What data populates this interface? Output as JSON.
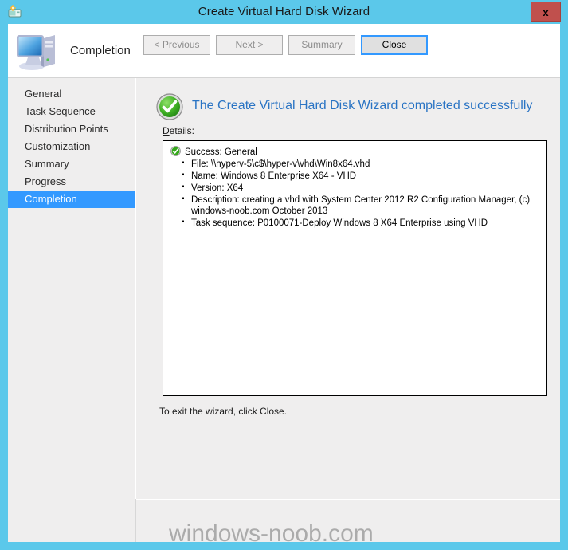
{
  "window": {
    "title": "Create Virtual Hard Disk Wizard",
    "title_icon": "vhd-wizard-icon",
    "close_label": "x",
    "accent_color": "#5bc8ea",
    "close_button_color": "#c0504d"
  },
  "header": {
    "icon": "computer-icon",
    "title": "Completion"
  },
  "sidebar": {
    "items": [
      {
        "label": "General",
        "active": false
      },
      {
        "label": "Task Sequence",
        "active": false
      },
      {
        "label": "Distribution Points",
        "active": false
      },
      {
        "label": "Customization",
        "active": false
      },
      {
        "label": "Summary",
        "active": false
      },
      {
        "label": "Progress",
        "active": false
      },
      {
        "label": "Completion",
        "active": true
      }
    ],
    "active_color": "#3399ff"
  },
  "content": {
    "status_icon": "success-check-icon",
    "status_text": "The Create Virtual Hard Disk Wizard completed successfully",
    "status_color": "#2a74c4",
    "details_label": "Details:",
    "details": {
      "heading_icon": "success-check-small-icon",
      "heading": "Success: General",
      "items": [
        "File:  \\\\hyperv-5\\c$\\hyper-v\\vhd\\Win8x64.vhd",
        "Name: Windows 8 Enterprise X64 - VHD",
        "Version: X64",
        "Description: creating a vhd with System Center 2012 R2 Configuration Manager, (c) windows-noob.com October 2013",
        "Task sequence: P0100071-Deploy Windows 8 X64 Enterprise using VHD"
      ]
    },
    "exit_note": "To exit the wizard, click Close."
  },
  "footer": {
    "buttons": [
      {
        "label": "< Previous",
        "accel": "P",
        "enabled": false
      },
      {
        "label": "Next >",
        "accel": "N",
        "enabled": false
      },
      {
        "label": "Summary",
        "accel": "S",
        "enabled": false
      },
      {
        "label": "Close",
        "accel": "",
        "enabled": true
      }
    ]
  },
  "watermark": {
    "text": "windows-noob.com"
  }
}
